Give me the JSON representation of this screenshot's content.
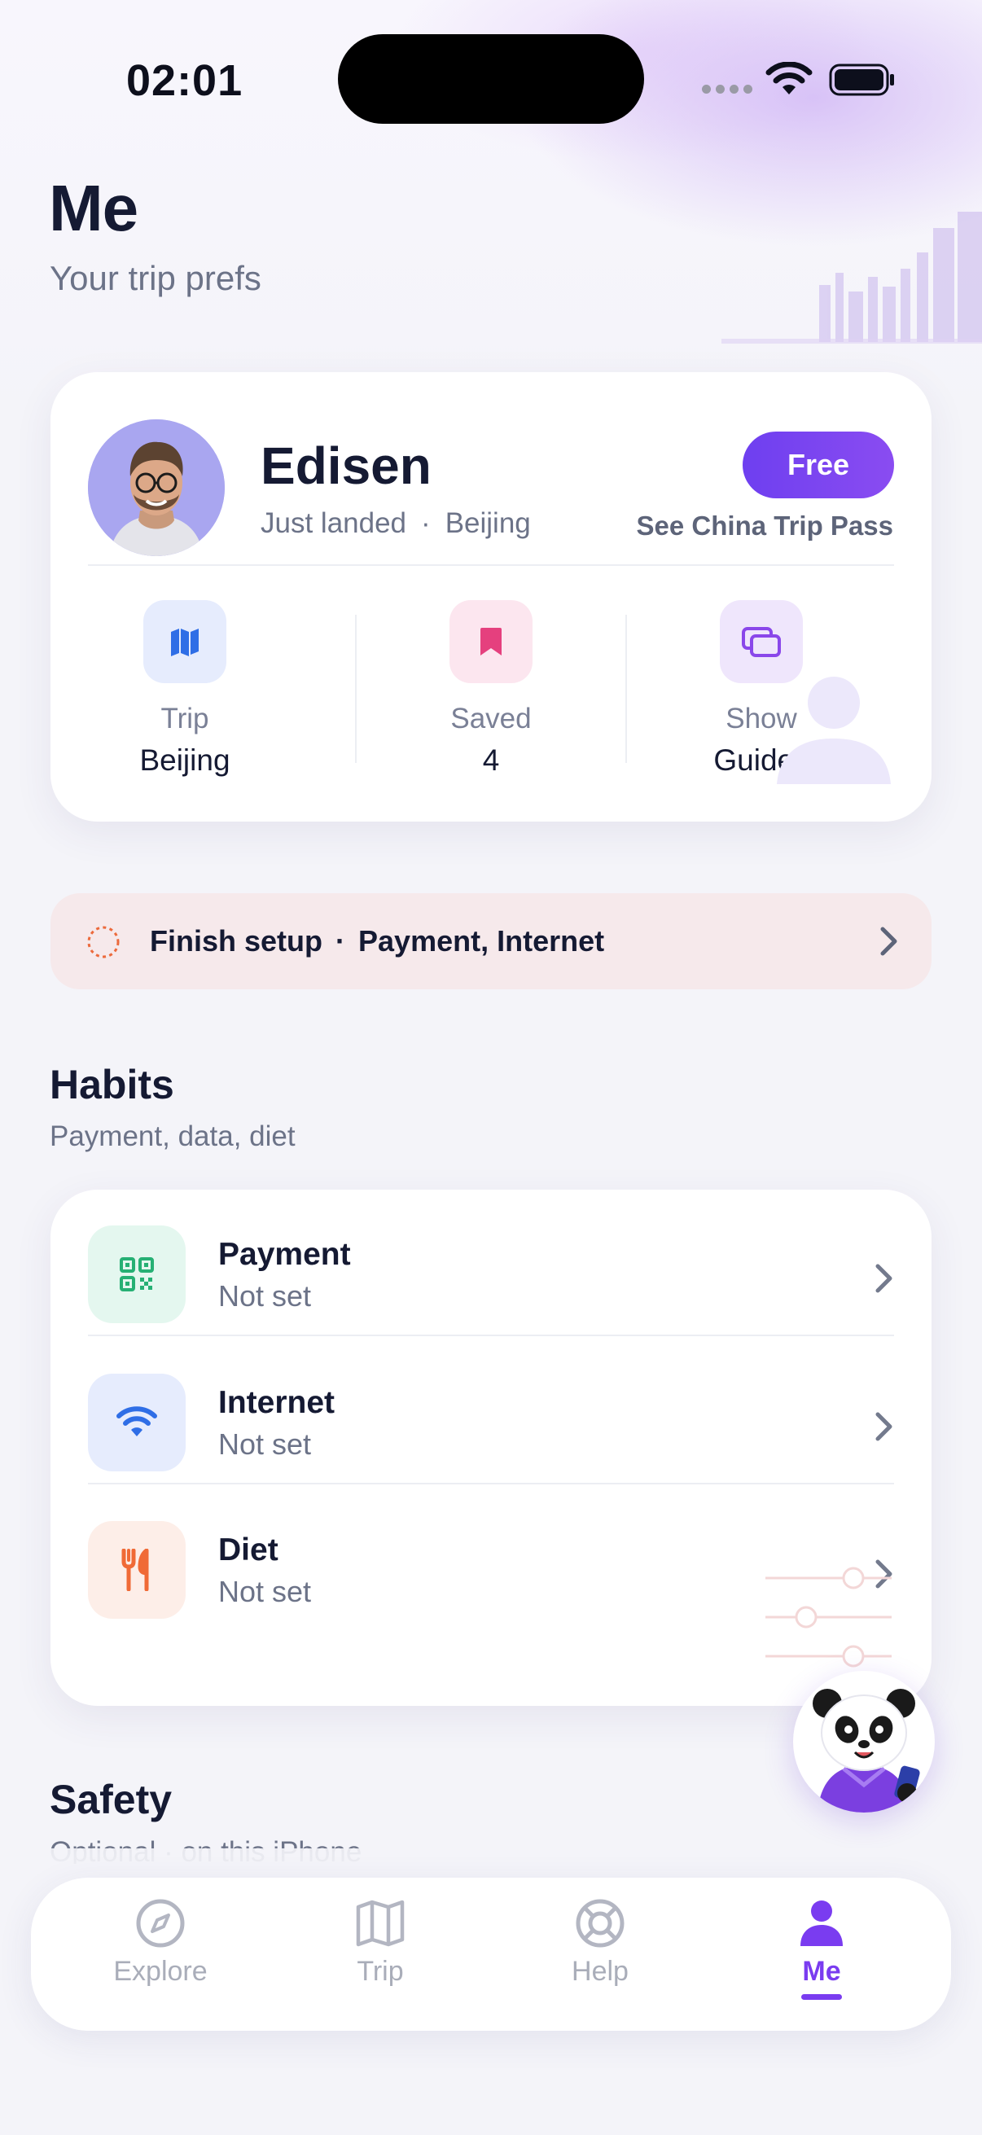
{
  "status_bar": {
    "time": "02:01"
  },
  "page": {
    "title": "Me",
    "subtitle": "Your trip prefs"
  },
  "profile": {
    "name": "Edisen",
    "status": "Just landed",
    "city": "Beijing",
    "plan_badge": "Free",
    "pass_link": "See China Trip Pass",
    "stats": [
      {
        "label": "Trip",
        "value": "Beijing",
        "icon": "map-icon"
      },
      {
        "label": "Saved",
        "value": "4",
        "icon": "bookmark-icon"
      },
      {
        "label": "Show",
        "value": "Guides",
        "icon": "cards-icon"
      }
    ]
  },
  "setup_banner": {
    "label": "Finish setup",
    "items": "Payment, Internet"
  },
  "habits": {
    "title": "Habits",
    "subtitle": "Payment, data, diet",
    "items": [
      {
        "title": "Payment",
        "value": "Not set",
        "icon": "qr-code-icon"
      },
      {
        "title": "Internet",
        "value": "Not set",
        "icon": "wifi-icon"
      },
      {
        "title": "Diet",
        "value": "Not set",
        "icon": "fork-knife-icon"
      }
    ]
  },
  "safety": {
    "title": "Safety",
    "subtitle": "Optional · on this iPhone"
  },
  "tab_bar": {
    "tabs": [
      {
        "label": "Explore",
        "icon": "compass-icon"
      },
      {
        "label": "Trip",
        "icon": "map-icon"
      },
      {
        "label": "Help",
        "icon": "lifebuoy-icon"
      },
      {
        "label": "Me",
        "icon": "person-icon"
      }
    ],
    "active": "Me"
  },
  "colors": {
    "accent": "#7a3cf0",
    "text_primary": "#151a33",
    "text_secondary": "#6c7388",
    "setup_bg": "#f6e9eb",
    "payment_tint": "#e4f7ef",
    "internet_tint": "#e6ecfd",
    "diet_tint": "#fdeee8"
  }
}
